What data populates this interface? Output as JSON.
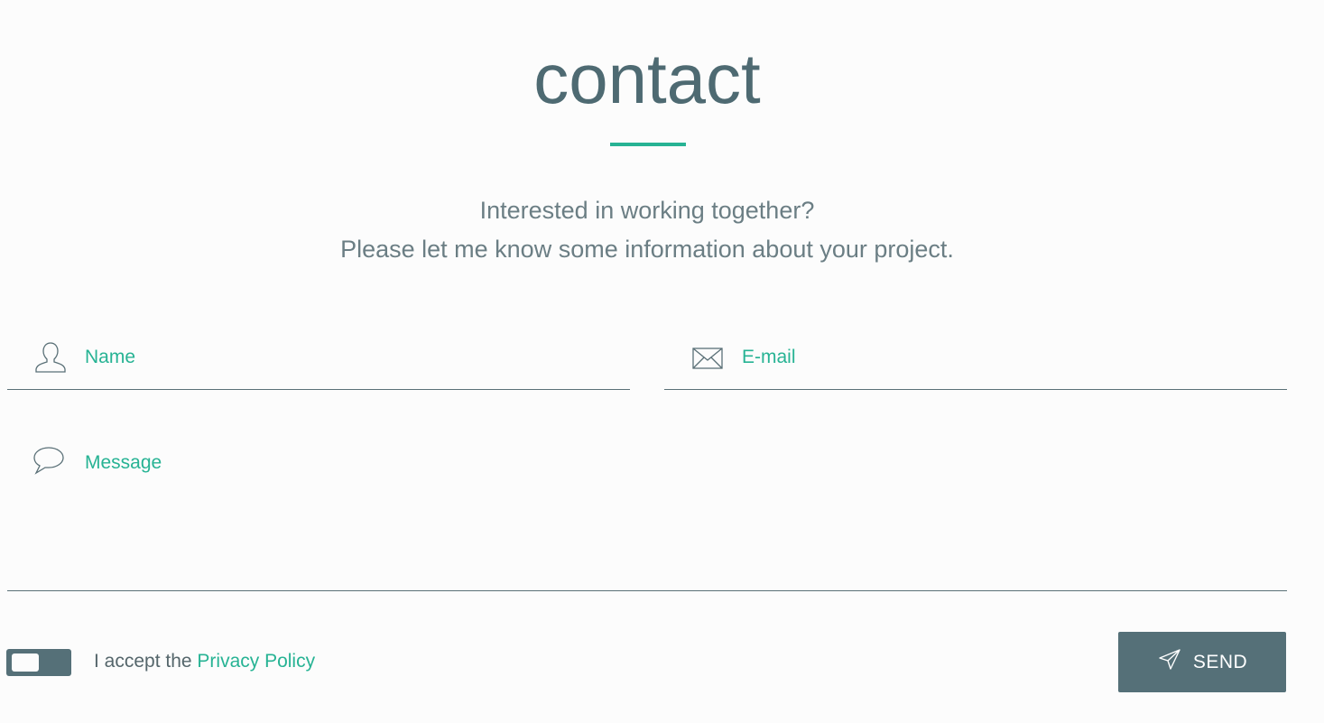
{
  "header": {
    "title": "contact",
    "subtitle_line1": "Interested in working together?",
    "subtitle_line2": "Please let me know some information about your project."
  },
  "form": {
    "name": {
      "label": "Name",
      "icon": "user-icon"
    },
    "email": {
      "label": "E-mail",
      "icon": "envelope-icon"
    },
    "message": {
      "label": "Message",
      "icon": "speech-bubble-icon"
    },
    "consent": {
      "prefix": "I accept the ",
      "link": "Privacy Policy",
      "checked": false
    },
    "send": {
      "label": "SEND",
      "icon": "paper-plane-icon"
    }
  },
  "colors": {
    "accent": "#27b394",
    "primary": "#557078",
    "title": "#4e6a72",
    "background": "#fcfcfc"
  }
}
